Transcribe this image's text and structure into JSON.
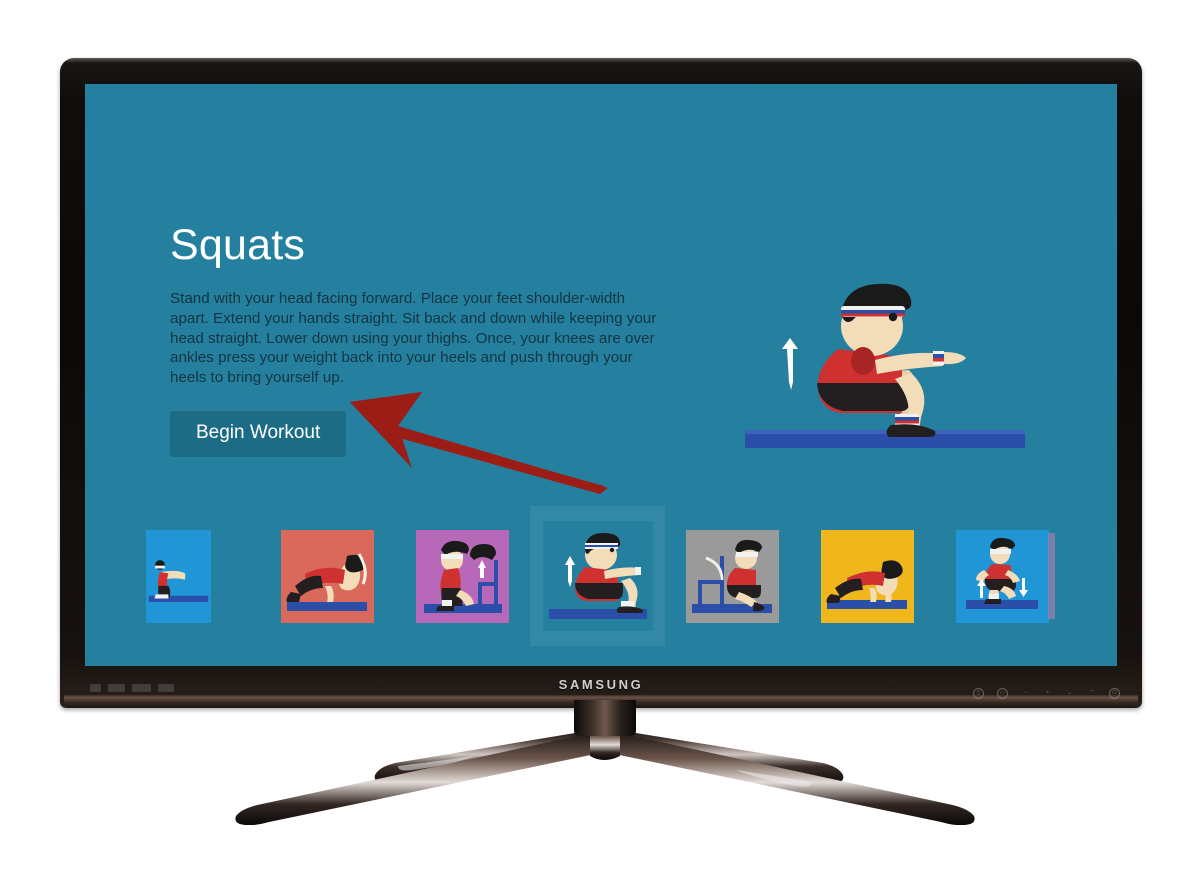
{
  "device": {
    "brand_logo": "SAMSUNG",
    "bezel_controls": [
      "menu-button",
      "source-button",
      "volume-down-button",
      "volume-up-button",
      "channel-down-button",
      "channel-up-button",
      "power-button"
    ],
    "cert_logos": [
      "energy-star-logo",
      "hdmi-logo",
      "dolby-digital-logo",
      "dtv-logo"
    ]
  },
  "screen": {
    "background_color": "#2580a0",
    "title": "Squats",
    "instructions": "Stand with your head facing forward. Place your feet shoulder-width apart. Extend your hands straight. Sit back and down while keeping your head straight. Lower down using your thighs. Once, your knees are over ankles press your weight back into your heels and push through your heels to bring yourself up.",
    "primary_button": {
      "label": "Begin Workout",
      "background_color": "#1d6c86",
      "text_color": "#ffffff"
    },
    "hero": {
      "icon": "squat-exercise-illustration",
      "arrow_direction": "up",
      "skin_color": "#f3ddb8",
      "shirt_color": "#cf3030",
      "shorts_color": "#231f20",
      "floor_color": "#2b4fa8",
      "hair_color": "#1a1a1a",
      "headband_color": "#f2f2f2"
    },
    "carousel": {
      "selected_index": 3,
      "edge_marker_color": "#a07fa8",
      "items": [
        {
          "name": "thumbnail-pushup-variation",
          "exercise": "Push Up",
          "background_color": "#2196d6",
          "pose": "pushup",
          "clipped": true
        },
        {
          "name": "thumbnail-plank-side",
          "exercise": "Plank",
          "background_color": "#d9695a",
          "pose": "plank-arc",
          "clipped": false
        },
        {
          "name": "thumbnail-step-up",
          "exercise": "Step Up",
          "background_color": "#b768b8",
          "pose": "chair-step-up",
          "clipped": false
        },
        {
          "name": "thumbnail-squats",
          "exercise": "Squats",
          "background_color": "#2580a0",
          "pose": "squat",
          "clipped": false
        },
        {
          "name": "thumbnail-chair-dip",
          "exercise": "Chair Dip",
          "background_color": "#9a9a9a",
          "pose": "chair-kick",
          "clipped": false
        },
        {
          "name": "thumbnail-push-up",
          "exercise": "Push Up",
          "background_color": "#f0b71c",
          "pose": "plank",
          "clipped": false
        },
        {
          "name": "thumbnail-high-knees",
          "exercise": "High Knees",
          "background_color": "#2196d6",
          "pose": "run",
          "clipped": false
        }
      ]
    }
  },
  "annotation": {
    "arrow": {
      "name": "red-pointer-arrow",
      "color": "#9c1c16",
      "points_to": "Begin Workout"
    }
  }
}
